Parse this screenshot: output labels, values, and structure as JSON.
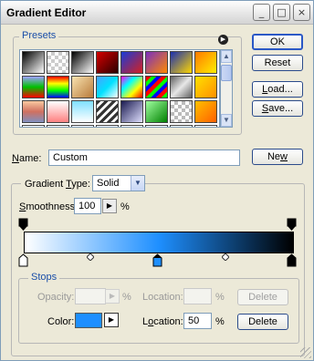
{
  "window": {
    "title": "Gradient Editor",
    "minimize": "_",
    "maximize": "□",
    "close": "×"
  },
  "presets": {
    "legend": "Presets",
    "menu_arrow": "▶",
    "swatches": [
      "linear-gradient(135deg,#000,#fff)",
      "repeating-conic-gradient(#ccc 0 25%,#fff 0 50%) 0 0/8px 8px",
      "linear-gradient(135deg,#000,#fff)",
      "linear-gradient(135deg,#d60000,#2a0000)",
      "linear-gradient(135deg,#1a3bd8,#d42020)",
      "linear-gradient(135deg,#7a2fc0,#ff8a00)",
      "linear-gradient(135deg,#1b2fb0,#ffd800)",
      "linear-gradient(135deg,#ff7a00,#ffee00)",
      "linear-gradient(180deg,#a0a0ff,#00c000,#ff0000)",
      "linear-gradient(180deg,#ff0000,#ffff00,#00ff00,#0000ff)",
      "linear-gradient(135deg,#f8e3b0,#b87a3a)",
      "linear-gradient(135deg,#4aa0ff,#00e0ff,#ffffff)",
      "linear-gradient(135deg,#ff00ff,#00ffff,#ffff00,#ff0000)",
      "repeating-linear-gradient(135deg,#ff0000 0 4px,#00ff00 4px 8px,#0000ff 8px 12px)",
      "linear-gradient(135deg,#606060,#e8e8e8,#606060)",
      "linear-gradient(135deg,#ffe000,#ff9000)",
      "linear-gradient(180deg,#f8c8a0,#d07060,#8090c0)",
      "linear-gradient(180deg,#ffffff,#ff8080)",
      "linear-gradient(180deg,#80e0ff,#ffffff)",
      "repeating-linear-gradient(135deg,#333 0 3px,#fff 3px 6px)",
      "linear-gradient(135deg,#1a1a50,#e0e0ff)",
      "linear-gradient(135deg,#a0ffa0,#008000)",
      "repeating-conic-gradient(#bbb 0 25%,#fff 0 50%) 0 0/8px 8px",
      "linear-gradient(135deg,#ffc000,#ff6000)",
      "linear-gradient(180deg,#ffffff,#80c8ff)",
      "linear-gradient(180deg,#ffffff,#ff80a0)",
      "linear-gradient(180deg,#ffffff,#e0e0e0)",
      "linear-gradient(180deg,#ffffff,#a0a0ff)",
      "linear-gradient(180deg,#ffffff,#ff6060)",
      "linear-gradient(180deg,#ffffff,#60e0ff)",
      "linear-gradient(180deg,#ffffff,#40ff40)",
      "linear-gradient(180deg,#ffffff,#ffe040)"
    ]
  },
  "buttons": {
    "ok": "OK",
    "reset": "Reset",
    "load_first": "L",
    "load_rest": "oad...",
    "save_first": "S",
    "save_rest": "ave...",
    "new_first": "Ne",
    "new_u": "w",
    "delete": "Delete"
  },
  "name": {
    "label_u": "N",
    "label_rest": "ame:",
    "value": "Custom"
  },
  "gradient": {
    "legend_pre": "Gradient ",
    "legend_u": "T",
    "legend_post": "ype:",
    "type_value": "Solid",
    "smooth_u": "S",
    "smooth_rest": "moothness:",
    "smoothness": "100",
    "percent": "%",
    "colors": [
      "#ffffff",
      "#1e8fff",
      "#000000"
    ],
    "selected_stop": 0.5
  },
  "stops": {
    "legend": "Stops",
    "opacity_label": "Opacity:",
    "opacity_value": "",
    "percent": "%",
    "location_label": "Location:",
    "location_value_disabled": "",
    "color_label": "Color:",
    "color_value": "#1e8fff",
    "color_location_label_pre": "L",
    "color_location_label_u": "o",
    "color_location_label_post": "cation:",
    "color_location_value": "50"
  }
}
